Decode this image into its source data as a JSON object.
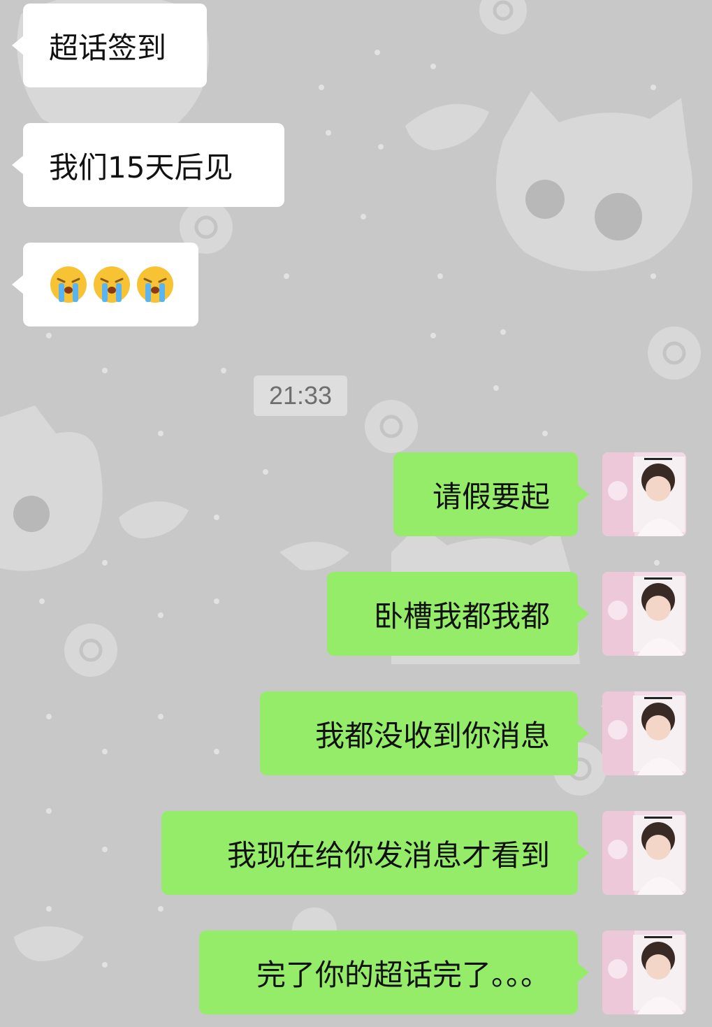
{
  "messages": {
    "incoming": [
      {
        "text": "超话签到"
      },
      {
        "text": "我们15天后见"
      },
      {
        "emoji": [
          "crying-face",
          "crying-face",
          "crying-face"
        ]
      }
    ],
    "timestamp": "21:33",
    "outgoing": [
      {
        "text": "请假要起"
      },
      {
        "text": "卧槽我都我都"
      },
      {
        "text": "我都没收到你消息"
      },
      {
        "text": "我现在给你发消息才看到"
      },
      {
        "text": "完了你的超话完了。。。"
      }
    ]
  },
  "colors": {
    "background": "#c8c8c8",
    "incoming_bubble": "#ffffff",
    "outgoing_bubble": "#95ec69",
    "timestamp_bg": "#dedede",
    "timestamp_text": "#6e6e6e"
  }
}
